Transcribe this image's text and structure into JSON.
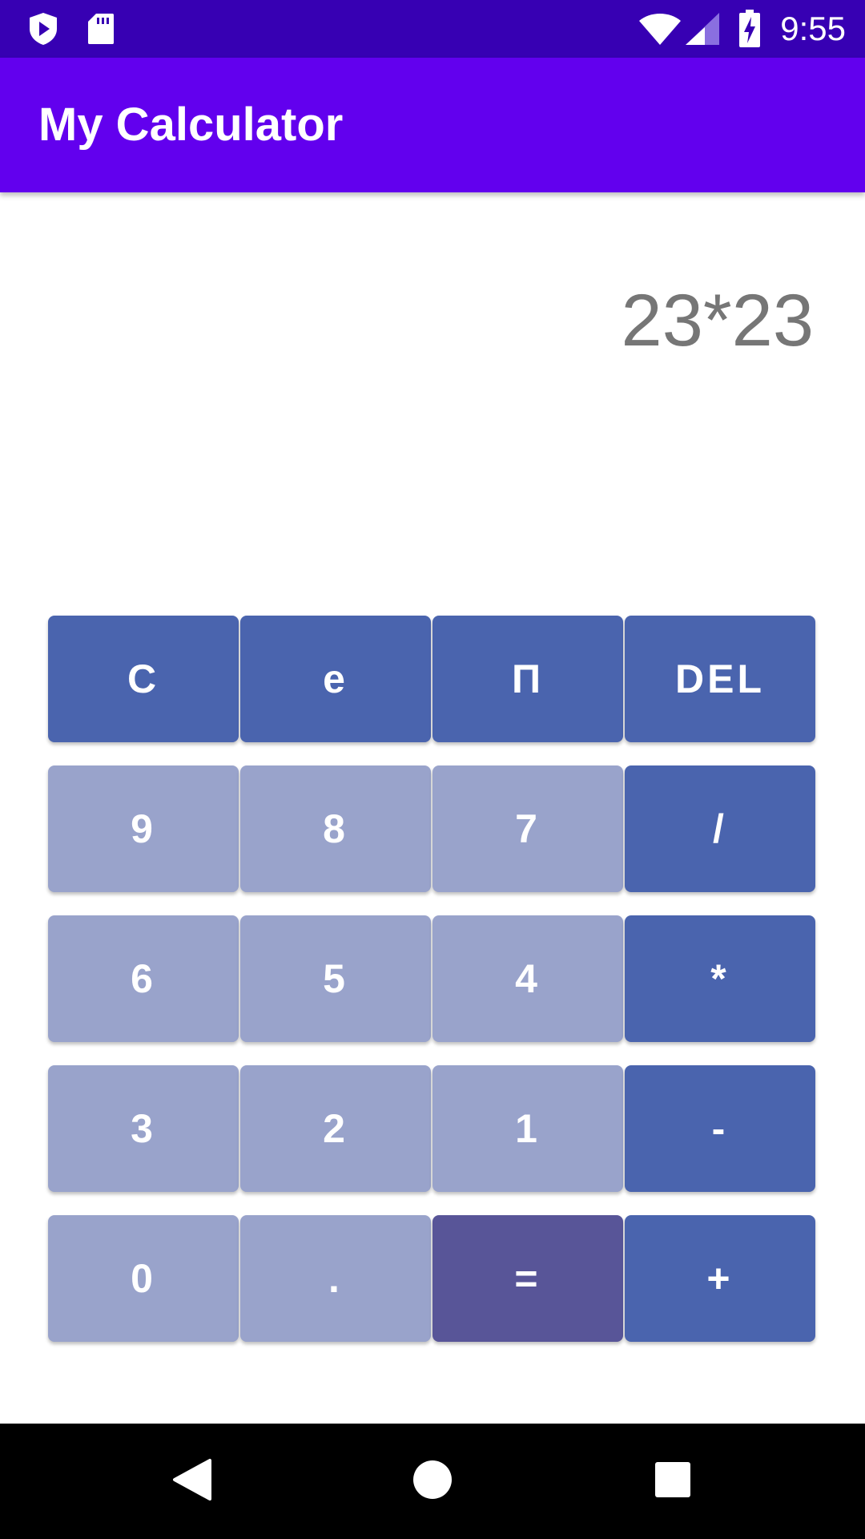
{
  "status_bar": {
    "time": "9:55",
    "icons": [
      "play-protect-icon",
      "sd-card-icon",
      "wifi-icon",
      "cell-signal-icon",
      "battery-charging-icon"
    ]
  },
  "app_bar": {
    "title": "My Calculator"
  },
  "display": {
    "expression": "23*23"
  },
  "keypad": {
    "rows": [
      [
        {
          "label": "C",
          "style": "func"
        },
        {
          "label": "e",
          "style": "func"
        },
        {
          "label": "Π",
          "style": "func"
        },
        {
          "label": "DEL",
          "style": "func"
        }
      ],
      [
        {
          "label": "9",
          "style": "num"
        },
        {
          "label": "8",
          "style": "num"
        },
        {
          "label": "7",
          "style": "num"
        },
        {
          "label": "/",
          "style": "func"
        }
      ],
      [
        {
          "label": "6",
          "style": "num"
        },
        {
          "label": "5",
          "style": "num"
        },
        {
          "label": "4",
          "style": "num"
        },
        {
          "label": "*",
          "style": "func"
        }
      ],
      [
        {
          "label": "3",
          "style": "num"
        },
        {
          "label": "2",
          "style": "num"
        },
        {
          "label": "1",
          "style": "num"
        },
        {
          "label": "-",
          "style": "func"
        }
      ],
      [
        {
          "label": "0",
          "style": "num"
        },
        {
          "label": ".",
          "style": "num"
        },
        {
          "label": "=",
          "style": "equals"
        },
        {
          "label": "+",
          "style": "func"
        }
      ]
    ]
  },
  "nav_bar": {
    "buttons": [
      "back-icon",
      "home-icon",
      "recents-icon"
    ]
  },
  "colors": {
    "status_bar": "#3700b3",
    "app_bar": "#6200ee",
    "func_key": "#4a64ae",
    "num_key": "#99a3cb",
    "equals_key": "#585598",
    "display_text": "#767676"
  }
}
